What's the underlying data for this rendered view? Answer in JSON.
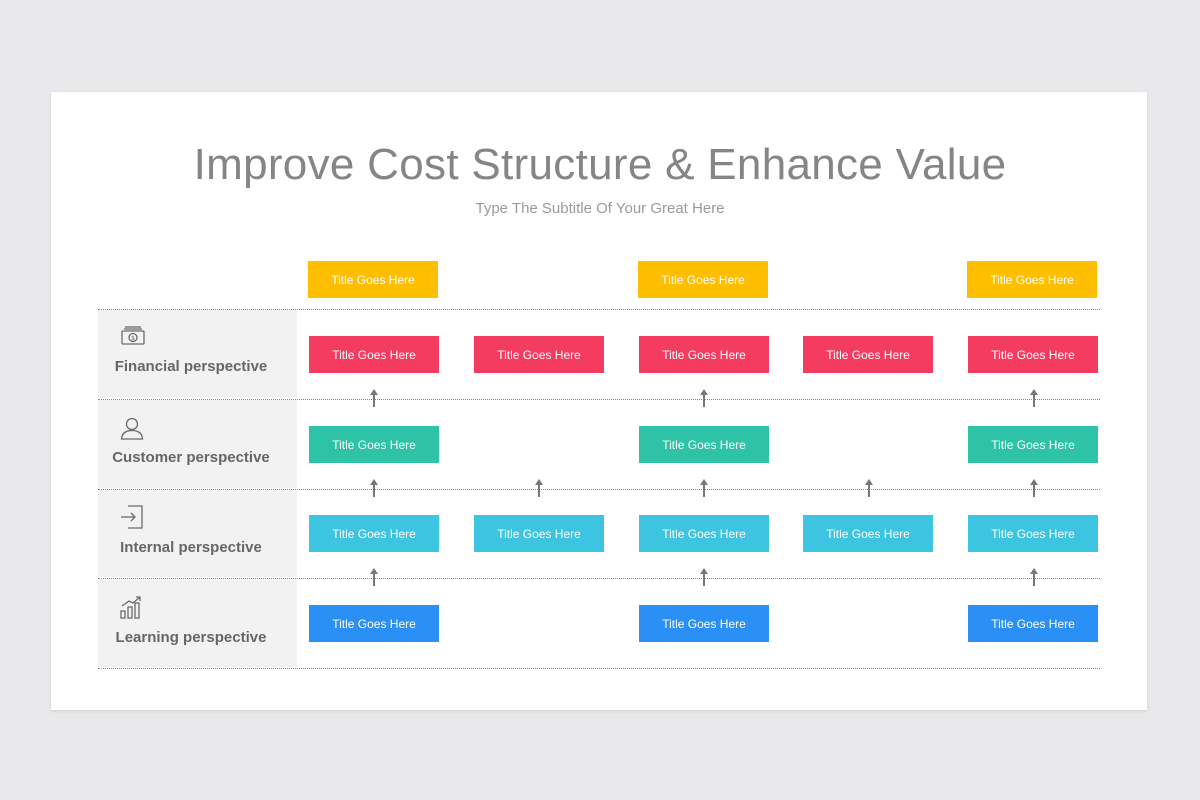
{
  "header": {
    "title": "Improve Cost Structure & Enhance Value",
    "subtitle": "Type The Subtitle Of Your Great Here"
  },
  "colors": {
    "yellow": "#ffbf00",
    "red": "#f33c5f",
    "teal": "#2ec3a6",
    "cyan": "#3cc4e0",
    "blue": "#2b90f5"
  },
  "top_row": {
    "color": "#ffbf00",
    "boxes": [
      "Title Goes Here",
      "Title Goes Here",
      "Title Goes Here"
    ]
  },
  "rows": [
    {
      "label": "Financial perspective",
      "icon": "money-icon",
      "color": "#f33c5f",
      "boxes": [
        "Title Goes Here",
        "Title Goes Here",
        "Title Goes Here",
        "Title Goes Here",
        "Title Goes Here"
      ]
    },
    {
      "label": "Customer perspective",
      "icon": "user-icon",
      "color": "#2ec3a6",
      "boxes": [
        "Title Goes Here",
        "Title Goes Here",
        "Title Goes Here"
      ]
    },
    {
      "label": "Internal perspective",
      "icon": "sign-in-icon",
      "color": "#3cc4e0",
      "boxes": [
        "Title Goes Here",
        "Title Goes Here",
        "Title Goes Here",
        "Title Goes Here",
        "Title Goes Here"
      ]
    },
    {
      "label": "Learning perspective",
      "icon": "growth-chart-icon",
      "color": "#2b90f5",
      "boxes": [
        "Title Goes Here",
        "Title Goes Here",
        "Title Goes Here"
      ]
    }
  ]
}
